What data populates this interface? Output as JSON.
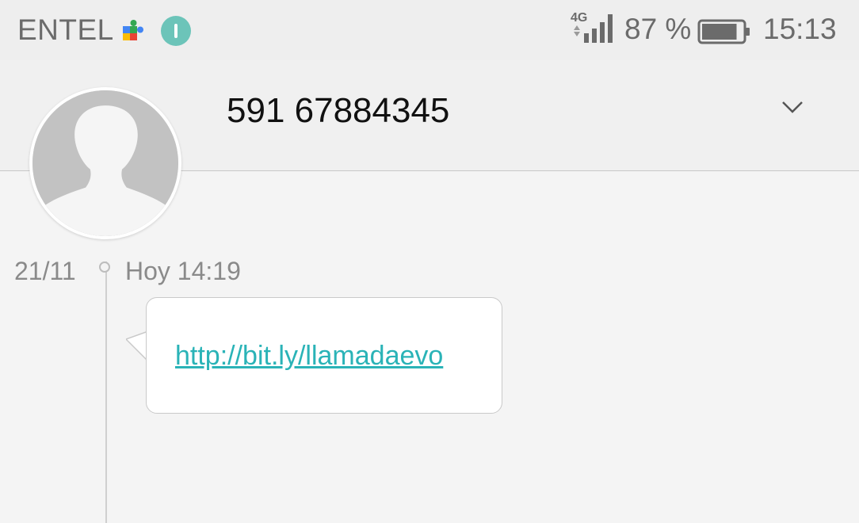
{
  "status_bar": {
    "carrier": "ENTEL",
    "network_type": "4G",
    "battery_percent": "87 %",
    "battery_level": 0.87,
    "time": "15:13",
    "icons": [
      "google-play-services-icon",
      "notification-badge-icon",
      "signal-icon",
      "battery-icon"
    ]
  },
  "conversation": {
    "contact_number": "591 67884345",
    "expand_icon": "chevron-down-icon",
    "avatar_icon": "default-contact-silhouette-icon"
  },
  "messages": [
    {
      "date": "21/11",
      "time": "Hoy 14:19",
      "text": "http://bit.ly/llamadaevo"
    }
  ],
  "colors": {
    "link": "#2ab3b7",
    "notification_dot": "#6cc4b9",
    "background": "#f4f4f4"
  }
}
